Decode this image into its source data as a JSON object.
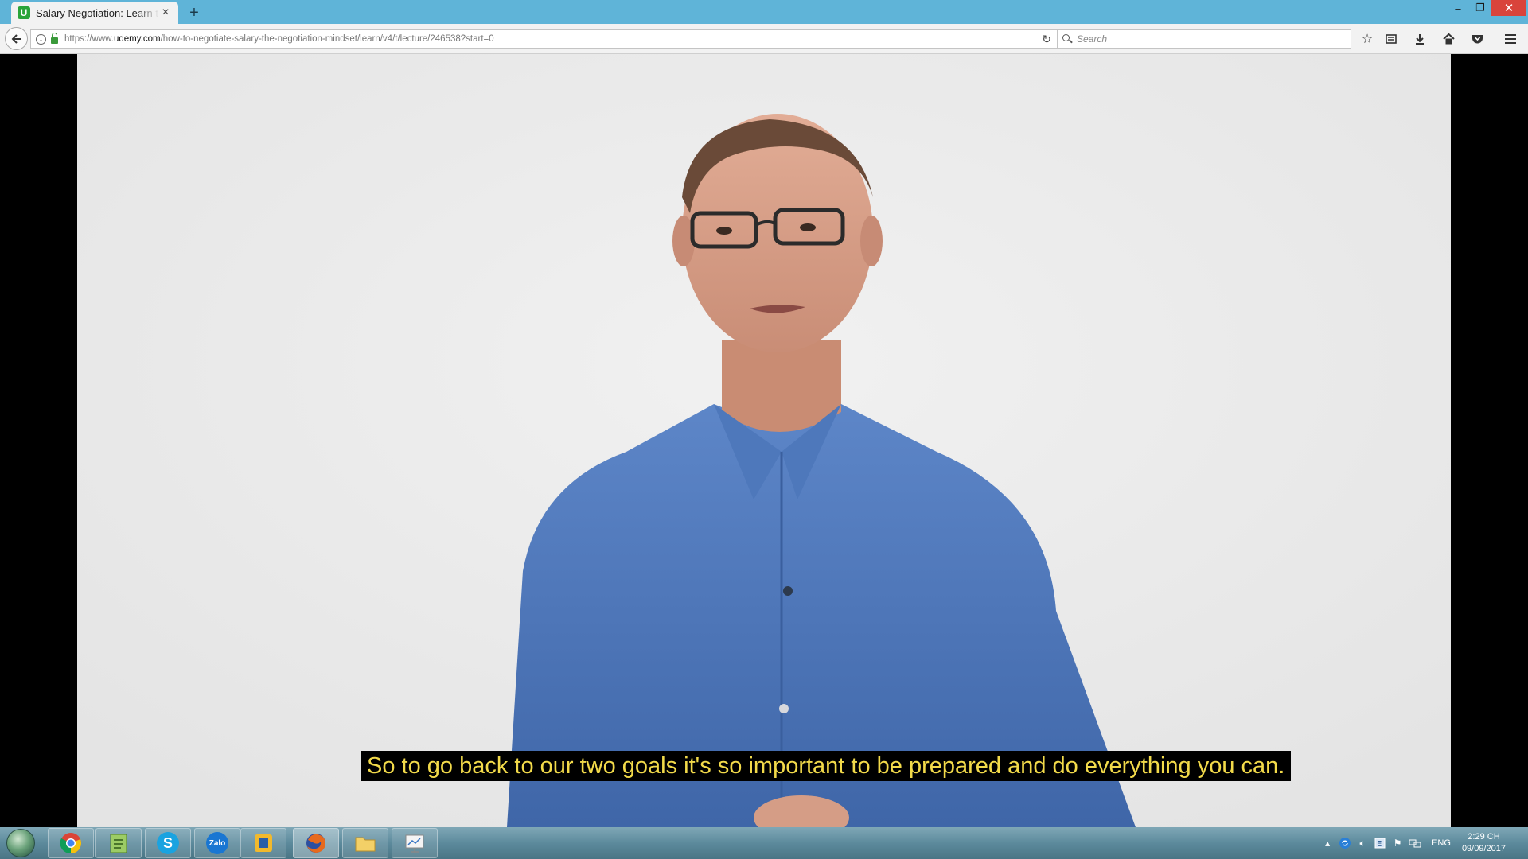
{
  "browser": {
    "tab": {
      "title": "Salary Negotiation: Learn the",
      "favicon_letter": "U"
    },
    "url": {
      "prefix": "https://www.",
      "domain": "udemy.com",
      "path": "/how-to-negotiate-salary-the-negotiation-mindset/learn/v4/t/lecture/246538?start=0"
    },
    "search_placeholder": "Search",
    "toolbar_icons": [
      "bookmark-star-icon",
      "reading-list-icon",
      "download-icon",
      "home-icon",
      "pocket-icon",
      "menu-icon"
    ]
  },
  "video": {
    "subtitle": "So to go back to our two goals it's so important to be prepared and do everything you can."
  },
  "taskbar": {
    "apps": [
      {
        "name": "chrome",
        "glyph": "",
        "color": "#e0463a"
      },
      {
        "name": "notepad-plus",
        "glyph": "✎",
        "color": "#7cb342"
      },
      {
        "name": "skype",
        "glyph": "S",
        "color": "#1aa3e0"
      },
      {
        "name": "zalo",
        "glyph": "Zalo",
        "color": "#1976d2"
      },
      {
        "name": "outlook",
        "glyph": "▣",
        "color": "#f2b92c"
      },
      {
        "name": "firefox",
        "glyph": "",
        "color": "#e66a1e"
      },
      {
        "name": "file-explorer",
        "glyph": "",
        "color": "#f3d067"
      },
      {
        "name": "presentation",
        "glyph": "",
        "color": "#dcdcdc"
      }
    ],
    "language": "ENG",
    "time": "2:29 CH",
    "date": "09/09/2017"
  }
}
